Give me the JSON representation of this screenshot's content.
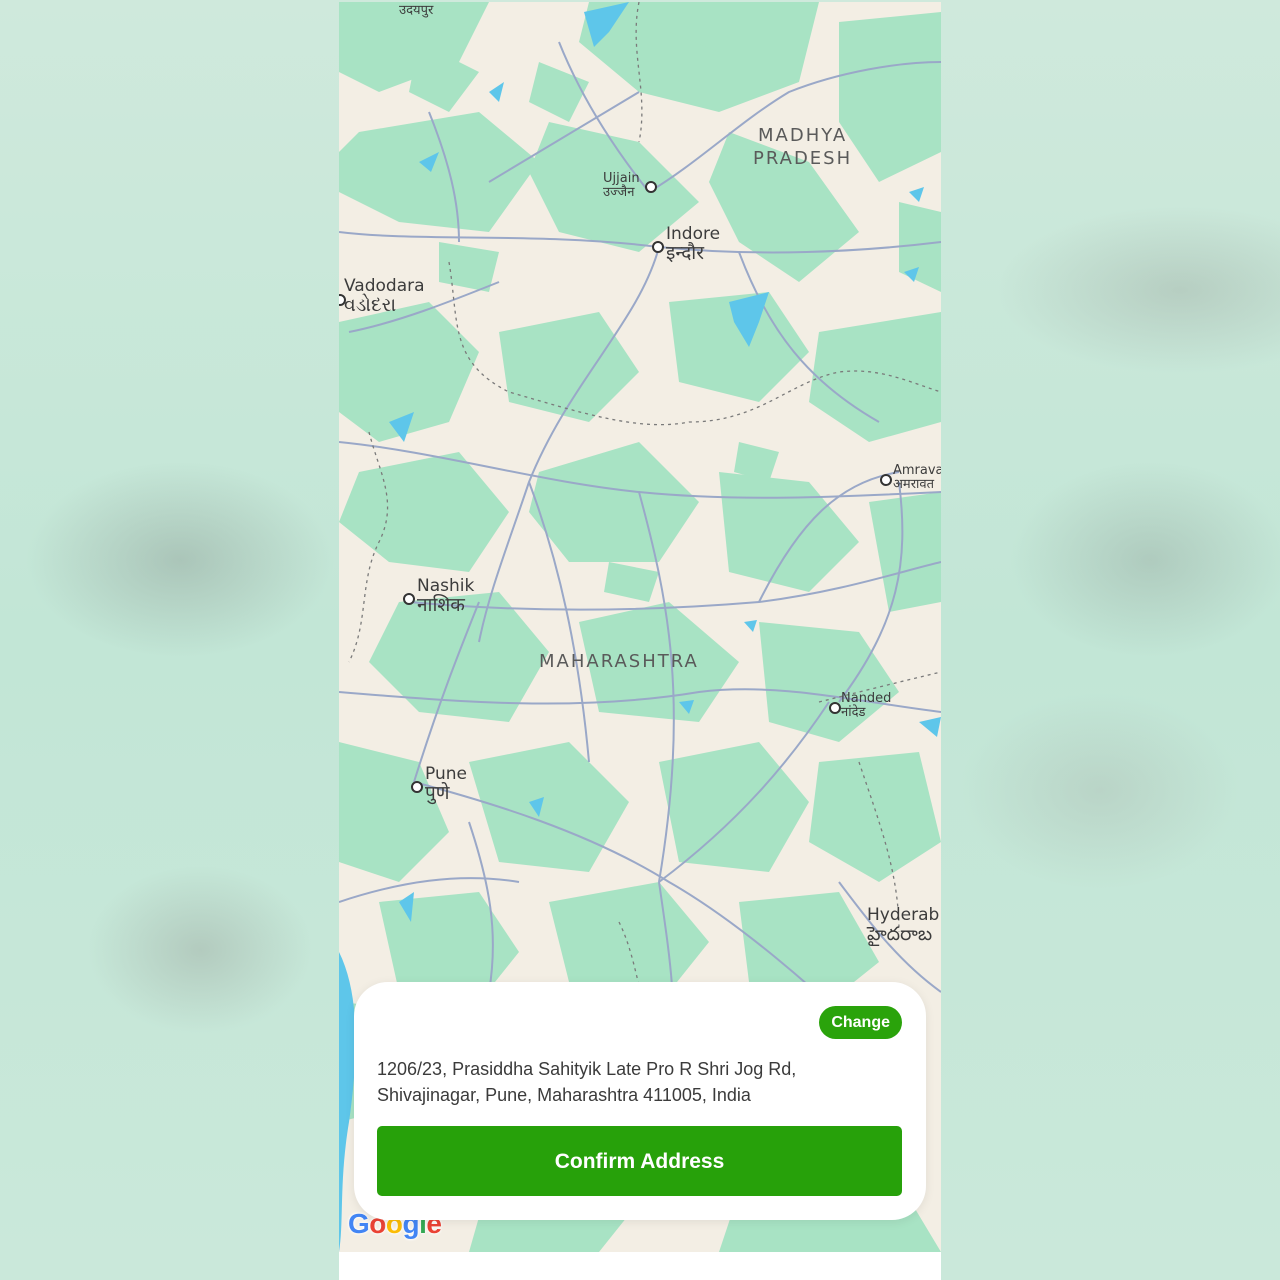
{
  "map": {
    "cities": [
      {
        "name": "Udaipur",
        "en": "",
        "local": "उदयपुर"
      },
      {
        "name": "Ujjain",
        "en": "Ujjain",
        "local": "उज्जैन"
      },
      {
        "name": "Indore",
        "en": "Indore",
        "local": "इन्दौर"
      },
      {
        "name": "Vadodara",
        "en": "Vadodara",
        "local": "વડોદરા"
      },
      {
        "name": "Amravati",
        "en": "Amrava",
        "local": "अमरावत"
      },
      {
        "name": "Nashik",
        "en": "Nashik",
        "local": "नाशिक"
      },
      {
        "name": "Nanded",
        "en": "Nanded",
        "local": "नांदेड"
      },
      {
        "name": "Pune",
        "en": "Pune",
        "local": "पुणे"
      },
      {
        "name": "Hyderabad",
        "en": "Hyderab",
        "local": "హైదరాబ"
      }
    ],
    "states": {
      "madhya_pradesh_line1": "MADHYA",
      "madhya_pradesh_line2": "PRADESH",
      "maharashtra": "MAHARASHTRA"
    },
    "attribution": {
      "letters": [
        "G",
        "o",
        "o",
        "g",
        "l",
        "e"
      ]
    },
    "colors": {
      "land": "#f3eee4",
      "vegetation": "#a8e3c4",
      "roads": "#9aa8c8",
      "water": "#5ec6ea",
      "border": "#7a7a7a"
    }
  },
  "sheet": {
    "change_label": "Change",
    "address": "1206/23, Prasiddha Sahityik Late Pro R Shri Jog Rd, Shivajinagar, Pune, Maharashtra 411005, India",
    "confirm_label": "Confirm Address",
    "accent_color": "#27a10a"
  }
}
